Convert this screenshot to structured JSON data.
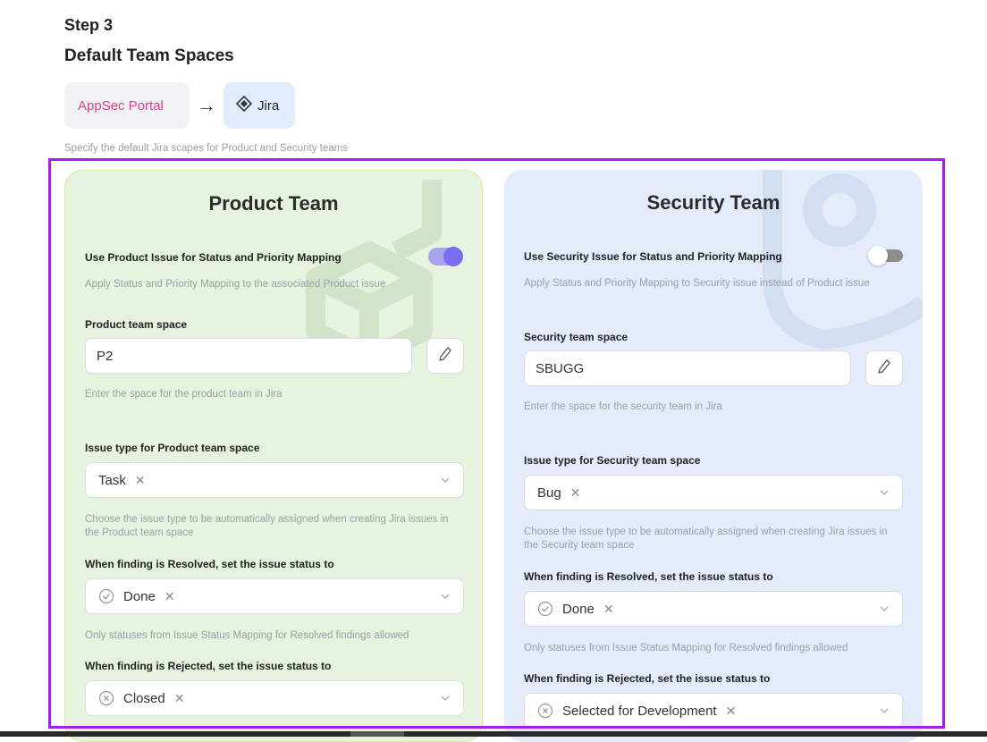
{
  "step": "Step 3",
  "title": "Default Team Spaces",
  "flow": {
    "source": "AppSec Portal",
    "target": "Jira"
  },
  "hint": "Specify the default Jira scapes for Product and Security teams",
  "product": {
    "heading": "Product Team",
    "mapping_label": "Use Product Issue for Status and Priority Mapping",
    "mapping_enabled": true,
    "mapping_hint": "Apply Status and Priority Mapping to the associated Product issue",
    "space_label": "Product team space",
    "space_value": "P2",
    "space_hint": "Enter the space for the product team in Jira",
    "issue_type_label": "Issue type for Product team space",
    "issue_type_value": "Task",
    "issue_type_hint": "Choose the issue type to be automatically assigned when creating Jira issues in the Product team space",
    "resolved_label": "When finding is Resolved, set the issue status to",
    "resolved_value": "Done",
    "resolved_hint": "Only statuses from Issue Status Mapping for Resolved findings allowed",
    "rejected_label": "When finding is Rejected, set the issue status to",
    "rejected_value": "Closed"
  },
  "security": {
    "heading": "Security Team",
    "mapping_label": "Use Security Issue for Status and Priority Mapping",
    "mapping_enabled": false,
    "mapping_hint": "Apply Status and Priority Mapping to Security issue instead of Product issue",
    "space_label": "Security team space",
    "space_value": "SBUGG",
    "space_hint": "Enter the space for the security team in Jira",
    "issue_type_label": "Issue type for Security team space",
    "issue_type_value": "Bug",
    "issue_type_hint": "Choose the issue type to be automatically assigned when creating Jira issues in the Security team space",
    "resolved_label": "When finding is Resolved, set the issue status to",
    "resolved_value": "Done",
    "resolved_hint": "Only statuses from Issue Status Mapping for Resolved findings allowed",
    "rejected_label": "When finding is Rejected, set the issue status to",
    "rejected_value": "Selected for Development"
  },
  "icons": {
    "arrow": "arrow-right-icon",
    "jira": "jira-icon",
    "edit": "pencil-icon",
    "dropdown": "chevron-down-icon",
    "remove": "close-icon",
    "resolved": "check-circle-icon",
    "rejected": "x-circle-icon"
  },
  "colors": {
    "accent": "#a41cf0",
    "appsec_text": "#e0408f",
    "toggle_on": "#7b6cf2",
    "product_bg": "#e5f3df",
    "security_bg": "#e4ecfb"
  }
}
